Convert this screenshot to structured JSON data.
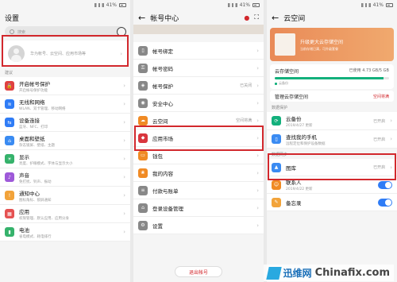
{
  "status": {
    "battery": "41%",
    "time": "下午"
  },
  "settings": {
    "title": "设置",
    "search_placeholder": "搜索",
    "account_text": "华为帐号、云空间、应用市场等",
    "section": "建议",
    "rows": [
      {
        "icon": "lock-icon",
        "color": "#e04040",
        "title": "开启帐号保护",
        "sub": "开启帐号保护功能"
      },
      {
        "icon": "wifi-icon",
        "color": "#2f7cf6",
        "title": "无线和网络",
        "sub": "WLAN、双卡管理、移动网络"
      },
      {
        "icon": "devices-icon",
        "color": "#2f7cf6",
        "title": "设备连接",
        "sub": "蓝牙、NFC、打印"
      },
      {
        "icon": "home-icon",
        "color": "#3a8bf2",
        "title": "桌面和壁纸",
        "sub": "杂志锁屏、壁纸、主题"
      },
      {
        "icon": "display-icon",
        "color": "#35b26b",
        "title": "显示",
        "sub": "亮度、护眼模式、字体与显示大小"
      },
      {
        "icon": "sound-icon",
        "color": "#9e59d9",
        "title": "声音",
        "sub": "免打扰、铃声、振动"
      },
      {
        "icon": "bell-icon",
        "color": "#f2a33a",
        "title": "通知中心",
        "sub": "图标角标、锁屏通知"
      },
      {
        "icon": "apps-icon",
        "color": "#e55151",
        "title": "应用",
        "sub": "权限管理、默认应用、应用分身"
      },
      {
        "icon": "battery-icon",
        "color": "#35b26b",
        "title": "电池",
        "sub": "省电模式、耗电排行"
      }
    ]
  },
  "account": {
    "title": "帐号中心",
    "rows": [
      {
        "icon": "phone-icon",
        "color": "#888",
        "title": "帐号绑定",
        "val": ""
      },
      {
        "icon": "key-icon",
        "color": "#888",
        "title": "帐号密码",
        "val": ""
      },
      {
        "icon": "shield-icon",
        "color": "#888",
        "title": "帐号保护",
        "val": "已关闭"
      },
      {
        "icon": "safe-icon",
        "color": "#888",
        "title": "安全中心",
        "val": ""
      },
      {
        "icon": "cloud-icon",
        "color": "#f08a24",
        "title": "云空间",
        "val": "空间将满"
      },
      {
        "icon": "store-icon",
        "color": "#d9363e",
        "title": "应用市场",
        "val": ""
      },
      {
        "icon": "wallet-icon",
        "color": "#f08a24",
        "title": "钱包",
        "val": ""
      },
      {
        "icon": "theme-icon",
        "color": "#f08a24",
        "title": "我的内容",
        "val": ""
      },
      {
        "icon": "pay-icon",
        "color": "#888",
        "title": "付款与账单",
        "val": ""
      },
      {
        "icon": "login-icon",
        "color": "#888",
        "title": "登录设备管理",
        "val": ""
      },
      {
        "icon": "gear-icon",
        "color": "#888",
        "title": "设置",
        "val": ""
      }
    ],
    "logout": "退出帐号"
  },
  "cloud": {
    "title": "云空间",
    "promo_title": "升级更大云存储空间",
    "promo_sub": "当前存储已满，可升级套餐",
    "storage_label": "云存储空间",
    "storage_value": "已使用 4.73 GB/5 GB",
    "storage_fraction": 0.95,
    "legend": "云备份",
    "manage": "管理云存储空间",
    "manage_link": "空间将满",
    "section1": "数据保护",
    "backup_title": "云备份",
    "backup_date": "2019/4/27 更新",
    "backup_val": "已开启",
    "find_title": "查找我的手机",
    "find_sub": "远程定位和保护设备数据",
    "find_val": "已开启",
    "section2": "数据同步",
    "sync": [
      {
        "icon": "gallery-icon",
        "color": "#3a8bf2",
        "title": "图库",
        "sub": "",
        "val": "已开启",
        "toggle": false
      },
      {
        "icon": "contacts-icon",
        "color": "#f08a24",
        "title": "联系人",
        "sub": "2019/4/22 更新",
        "val": "",
        "toggle": true
      },
      {
        "icon": "notes-icon",
        "color": "#f2a33a",
        "title": "备忘录",
        "sub": "",
        "val": "",
        "toggle": true
      }
    ]
  },
  "watermark": {
    "cn": "迅维网",
    "site": "Chinafix.com"
  }
}
